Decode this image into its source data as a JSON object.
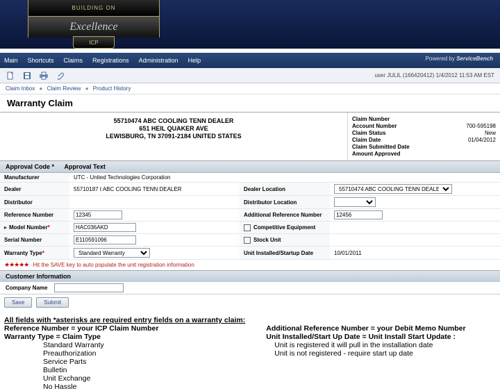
{
  "badge": {
    "top": "BUILDING ON",
    "script": "Excellence",
    "icp": "ICP"
  },
  "nav": {
    "items": [
      "Main",
      "Shortcuts",
      "Claims",
      "Registrations",
      "Administration",
      "Help"
    ],
    "powered_pre": "Powered by",
    "powered_brand": "ServiceBench"
  },
  "user_line": "user JULIL (166420412) 1/4/2012 11:53 AM EST",
  "breadcrumb": {
    "a": "Claim Inbox",
    "b": "Claim Review",
    "c": "Product History"
  },
  "page_title": "Warranty Claim",
  "dealer": {
    "line1": "55710474  ABC COOLING TENN DEALER",
    "line2": "651 HEIL QUAKER AVE",
    "line3": "LEWISBURG, TN 37091-2184 UNITED STATES"
  },
  "meta": {
    "claim_number_lbl": "Claim Number",
    "account_lbl": "Account Number",
    "account_val": "700-595198",
    "status_lbl": "Claim Status",
    "status_val": "New",
    "date_lbl": "Claim Date",
    "date_val": "01/04/2012",
    "submit_lbl": "Claim Submitted Date",
    "approved_lbl": "Amount Approved"
  },
  "approval_bar": {
    "code": "Approval Code *",
    "text": "Approval Text"
  },
  "fields": {
    "manufacturer_lbl": "Manufacturer",
    "manufacturer_val": "UTC - United Technologies Corporation",
    "dealer_lbl": "Dealer",
    "dealer_val": "55710187 t  ABC COOLING TENN DEALER",
    "dealer_loc_lbl": "Dealer Location",
    "dealer_loc_val": "55710474  ABC COOLING TENN DEALER",
    "distributor_lbl": "Distributor",
    "dist_loc_lbl": "Distributor Location",
    "refnum_lbl": "Reference Number",
    "refnum_val": "12345",
    "addref_lbl": "Additional Reference Number",
    "addref_val": "12456",
    "model_lbl": "Model Number",
    "model_val": "HAC036AKD",
    "comp_lbl": "Competitive Equipment",
    "serial_lbl": "Serial Number",
    "serial_val": "E110591096",
    "stock_lbl": "Stock Unit",
    "warranty_type_lbl": "Warranty Type",
    "warranty_type_val": "Standard Warranty",
    "install_lbl": "Unit Installed/Startup Date",
    "install_val": "10/01/2011",
    "star_text": "Hit the SAVE key to auto populate the unit registration information"
  },
  "cust": {
    "section": "Customer Information",
    "company": "Company Name"
  },
  "buttons": {
    "save": "Save",
    "submit": "Submit"
  },
  "notes": {
    "hd": "All fields with *asterisks are required entry fields on a warranty claim:",
    "l1": "Reference Number = your  ICP Claim Number",
    "l2": "Warranty Type = Claim Type",
    "i1": "Standard Warranty",
    "i2": "Preauthorization",
    "i3": "Service Parts",
    "i4": "Bulletin",
    "i5": "Unit Exchange",
    "i6": "No Hassle",
    "r1": "Additional Reference Number = your Debit Memo Number",
    "r2": "Unit Installed/Start Up Date = Unit Install Start Update :",
    "r3": "Unit is registered it will pull in the installation date",
    "r4": "Unit is not registered  - require start up date"
  }
}
